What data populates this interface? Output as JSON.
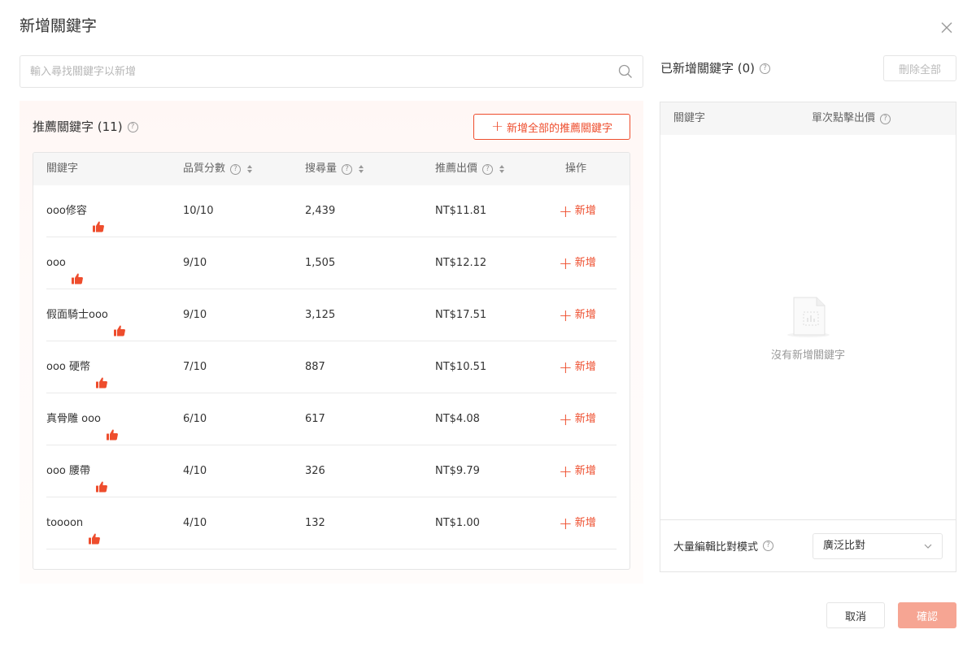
{
  "dialog": {
    "title": "新增關鍵字",
    "search": {
      "placeholder": "輸入尋找關鍵字以新增"
    },
    "recommended": {
      "title": "推薦關鍵字 (11)",
      "add_all_label": "新增全部的推薦關鍵字",
      "columns": {
        "keyword": "關鍵字",
        "quality": "品質分數",
        "volume": "搜尋量",
        "bid": "推薦出價",
        "action": "操作"
      },
      "rows": [
        {
          "keyword": "ooo修容",
          "quality": "10/10",
          "volume": "2,439",
          "bid": "NT$11.81",
          "action": "新增"
        },
        {
          "keyword": "ooo",
          "quality": "9/10",
          "volume": "1,505",
          "bid": "NT$12.12",
          "action": "新增"
        },
        {
          "keyword": "假面騎士ooo",
          "quality": "9/10",
          "volume": "3,125",
          "bid": "NT$17.51",
          "action": "新增"
        },
        {
          "keyword": "ooo 硬幣",
          "quality": "7/10",
          "volume": "887",
          "bid": "NT$10.51",
          "action": "新增"
        },
        {
          "keyword": "真骨雕 ooo",
          "quality": "6/10",
          "volume": "617",
          "bid": "NT$4.08",
          "action": "新增"
        },
        {
          "keyword": "ooo 腰帶",
          "quality": "4/10",
          "volume": "326",
          "bid": "NT$9.79",
          "action": "新增"
        },
        {
          "keyword": "toooon",
          "quality": "4/10",
          "volume": "132",
          "bid": "NT$1.00",
          "action": "新增"
        }
      ]
    },
    "added": {
      "title": "已新增關鍵字 (0)",
      "delete_all_label": "刪除全部",
      "columns": {
        "keyword": "關鍵字",
        "bid": "單次點擊出價"
      },
      "empty_text": "沒有新增關鍵字",
      "bulk_label": "大量編輯比對模式",
      "match_mode": "廣泛比對"
    },
    "footer": {
      "cancel_label": "取消",
      "confirm_label": "確認"
    },
    "colors": {
      "accent": "#ee4d2d",
      "confirm_disabled": "#f6a593"
    },
    "icons": [
      "close-icon",
      "search-icon",
      "help-icon",
      "plus-icon",
      "thumbs-up-icon",
      "sort-icon",
      "empty-file-icon",
      "chevron-down-icon"
    ]
  }
}
